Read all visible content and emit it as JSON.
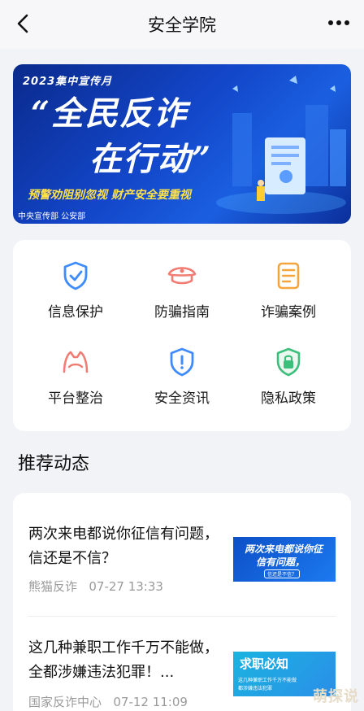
{
  "header": {
    "title": "安全学院",
    "back_icon": "chevron-left-icon",
    "more_icon": "more-dots-icon"
  },
  "banner": {
    "year_text": "2023集中宣传月",
    "headline_line1": "“全民反诈",
    "headline_line2": "在行动”",
    "slogan": "预警劝阻别忽视  财产安全要重视",
    "source": "中央宣传部   公安部"
  },
  "services": {
    "items": [
      {
        "label": "信息保护",
        "icon": "shield-check-icon",
        "color": "#3d8bff"
      },
      {
        "label": "防骗指南",
        "icon": "police-cap-icon",
        "color": "#f07c74"
      },
      {
        "label": "诈骗案例",
        "icon": "document-list-icon",
        "color": "#f5a53d"
      },
      {
        "label": "平台整治",
        "icon": "bell-cat-icon",
        "color": "#f07c74"
      },
      {
        "label": "安全资讯",
        "icon": "shield-alert-icon",
        "color": "#3d8bff"
      },
      {
        "label": "隐私政策",
        "icon": "shield-lock-icon",
        "color": "#3bbf7a"
      }
    ]
  },
  "feed": {
    "section_title": "推荐动态",
    "items": [
      {
        "headline": "两次来电都说你征信有问题，信还是不信？",
        "source": "熊猫反诈",
        "time": "07-27 13:33",
        "thumb_line1": "两次来电都说你征",
        "thumb_line2": "信有问题，",
        "thumb_line3": "信还是不信？"
      },
      {
        "headline": "这几种兼职工作千万不能做，全都涉嫌违法犯罪！...",
        "source": "国家反诈中心",
        "time": "07-12 11:09",
        "thumb_line1": "求职必知",
        "thumb_line2": "这几种兼职工作千万不能做",
        "thumb_line3": "都涉嫌违法犯罪"
      }
    ]
  },
  "watermark": "萌探说"
}
